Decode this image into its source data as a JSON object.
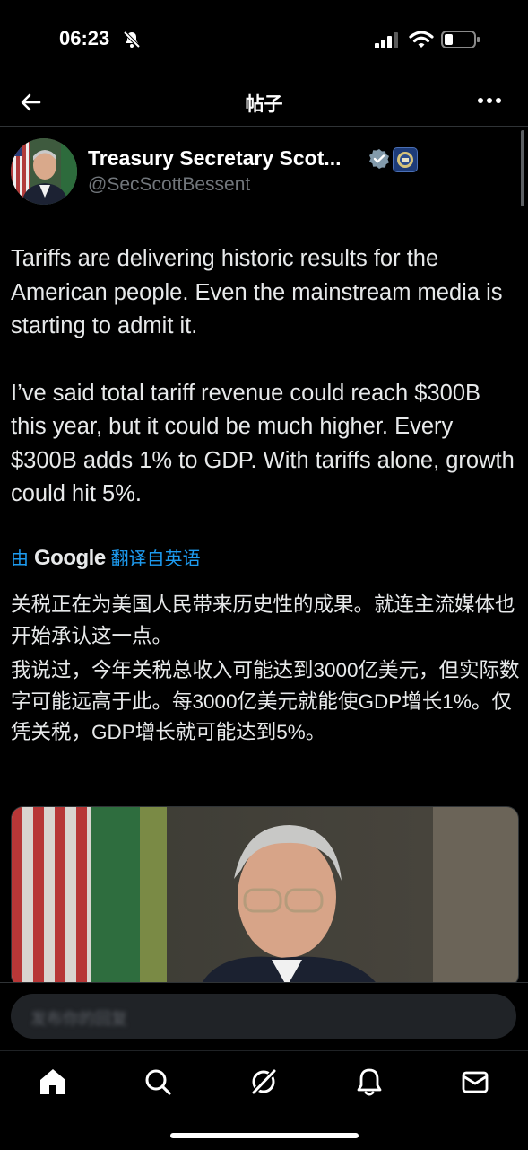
{
  "status_bar": {
    "time": "06:23"
  },
  "header": {
    "title": "帖子"
  },
  "author": {
    "name": "Treasury Secretary Scot...",
    "handle": "@SecScottBessent"
  },
  "tweet": {
    "para1": "Tariffs are delivering historic results for the American people. Even the mainstream media is starting to admit it.",
    "para2": "I’ve said total tariff revenue could reach $300B this year, but it could be much higher. Every $300B adds 1% to GDP. With tariffs alone, growth could hit 5%."
  },
  "translation": {
    "prefix": "由",
    "brand": "Google",
    "suffix": "翻译自英语",
    "para1": "关税正在为美国人民带来历史性的成果。就连主流媒体也开始承认这一点。",
    "para2": "我说过，今年关税总收入可能达到3000亿美元，但实际数字可能远高于此。每3000亿美元就能使GDP增长1%。仅凭关税，GDP增长就可能达到5%。"
  },
  "reply": {
    "placeholder": "发布你的回复"
  },
  "icons": {
    "back": "arrow-left-icon",
    "more": "more-horizontal-icon",
    "verified": "verified-badge-icon",
    "home": "home-icon",
    "search": "search-icon",
    "grok": "grok-icon",
    "notifications": "bell-icon",
    "messages": "mail-icon"
  },
  "colors": {
    "accent": "#1d9bf0",
    "background": "#000000",
    "text": "#e7e9ea",
    "muted": "#71767b"
  }
}
